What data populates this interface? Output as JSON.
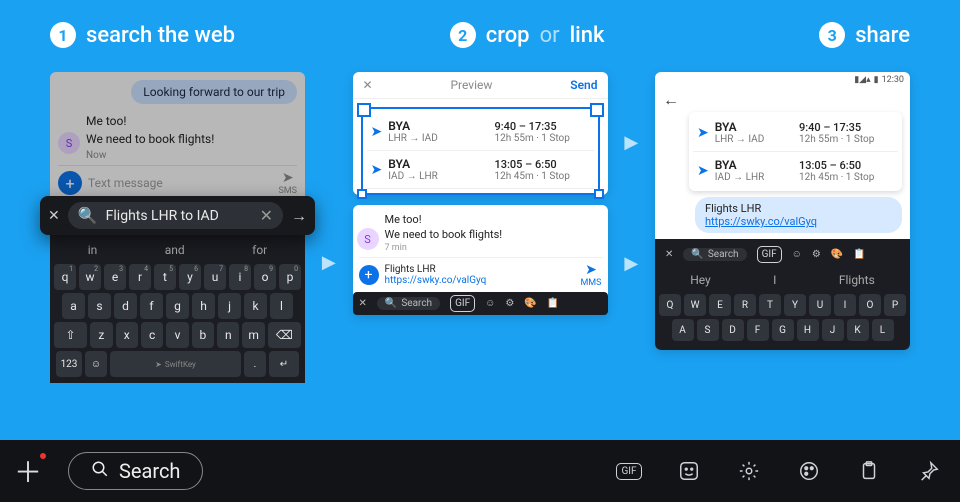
{
  "steps": {
    "s1": {
      "label": "search the web"
    },
    "s2": {
      "a": "crop",
      "mid": "or",
      "b": "link"
    },
    "s3": {
      "label": "share"
    }
  },
  "panel1": {
    "incoming": "Looking forward to our trip",
    "m1": "Me too!",
    "m2": "We need to book flights!",
    "time": "Now",
    "avatar": "S",
    "compose_placeholder": "Text message",
    "sms": "SMS",
    "search_query": "Flights LHR to IAD",
    "suggestions": [
      "in",
      "and",
      "for"
    ],
    "brand": "SwiftKey",
    "sym_key": "123"
  },
  "panel2": {
    "preview": "Preview",
    "send": "Send",
    "flights": [
      {
        "code": "BYA",
        "route": "LHR → IAD",
        "time": "9:40 – 17:35",
        "meta": "12h 55m · 1 Stop"
      },
      {
        "code": "BYA",
        "route": "IAD → LHR",
        "time": "13:05 – 6:50",
        "meta": "12h 45m · 1 Stop"
      }
    ],
    "m1": "Me too!",
    "m2": "We need to book flights!",
    "tm": "7 min",
    "link_label": "Flights LHR",
    "link_url": "https://swky.co/valGyq",
    "mms": "MMS",
    "toolbar_search": "Search"
  },
  "panel3": {
    "clock": "12:30",
    "flights": [
      {
        "code": "BYA",
        "route": "LHR → IAD",
        "time": "9:40 – 17:35",
        "meta": "12h 55m · 1 Stop"
      },
      {
        "code": "BYA",
        "route": "IAD → LHR",
        "time": "13:05 – 6:50",
        "meta": "12h 45m · 1 Stop"
      }
    ],
    "link_label": "Flights LHR",
    "link_url": "https://swky.co/valGyq",
    "toolbar_search": "Search",
    "suggestions": [
      "Hey",
      "I",
      "Flights"
    ]
  },
  "bottombar": {
    "search": "Search",
    "gif": "GIF"
  }
}
